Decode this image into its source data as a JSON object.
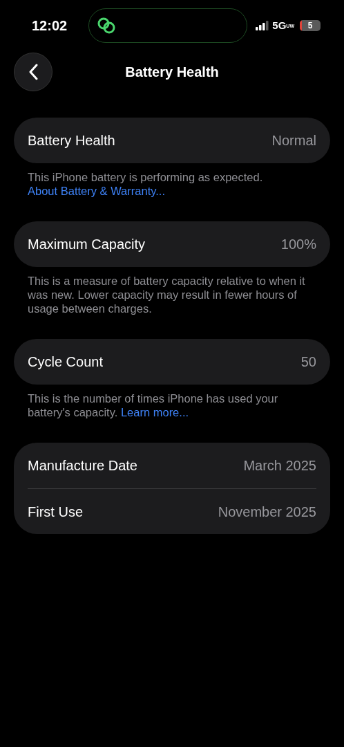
{
  "status_bar": {
    "time": "12:02",
    "network": "5G",
    "network_sub": "UW",
    "battery": "5"
  },
  "nav": {
    "title": "Battery Health"
  },
  "groups": [
    {
      "rows": [
        {
          "label": "Battery Health",
          "value": "Normal"
        }
      ],
      "footer": {
        "text": "This iPhone battery is performing as expected.",
        "link": "About Battery & Warranty..."
      }
    },
    {
      "rows": [
        {
          "label": "Maximum Capacity",
          "value": "100%"
        }
      ],
      "footer": {
        "text": "This is a measure of battery capacity relative to when it was new. Lower capacity may result in fewer hours of usage between charges."
      }
    },
    {
      "rows": [
        {
          "label": "Cycle Count",
          "value": "50"
        }
      ],
      "footer": {
        "text": "This is the number of times iPhone has used your battery's capacity.",
        "link": "Learn more..."
      }
    },
    {
      "rows": [
        {
          "label": "Manufacture Date",
          "value": "March 2025"
        },
        {
          "label": "First Use",
          "value": "November 2025"
        }
      ]
    }
  ]
}
